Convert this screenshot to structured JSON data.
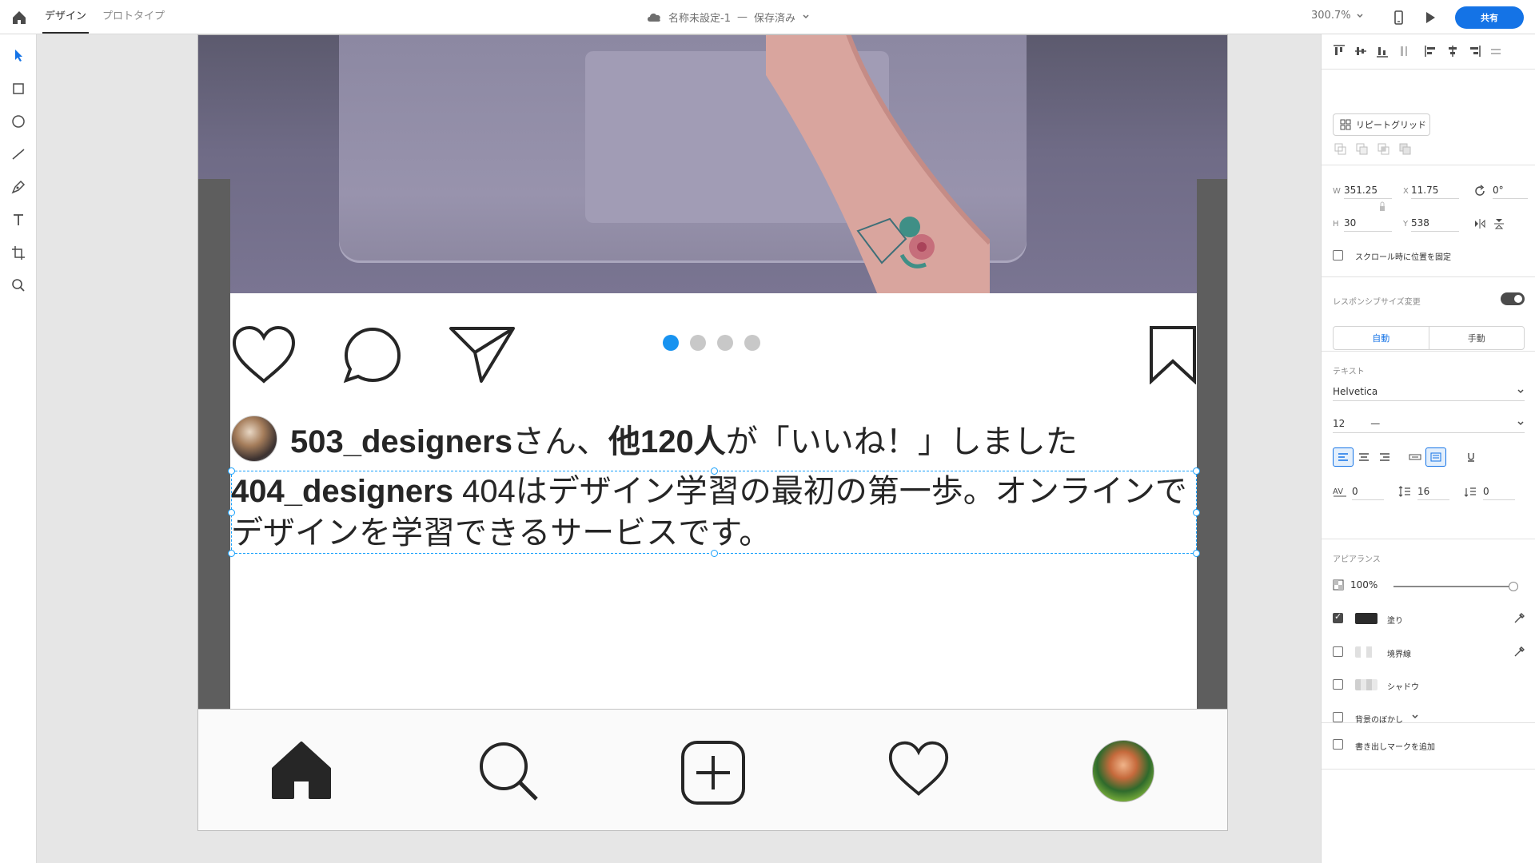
{
  "topbar": {
    "tab_design": "デザイン",
    "tab_prototype": "プロトタイプ",
    "doc_name": "名称未設定-1",
    "doc_sep": "—",
    "doc_status": "保存済み",
    "zoom": "300.7%",
    "share_label": "共有"
  },
  "post": {
    "likes_user": "503_designers",
    "likes_mid": "さん、",
    "likes_count": "他120人",
    "likes_tail": "が「いいね！」しました",
    "caption_user": "404_designers",
    "caption_text": " 404はデザイン学習の最初の第一歩。オンラインでデザインを学習できるサービスです。",
    "carousel_total": 4,
    "carousel_active": 1
  },
  "panel": {
    "repeat_grid": "リピートグリッド",
    "w_label": "W",
    "w_value": "351.25",
    "x_label": "X",
    "x_value": "11.75",
    "rotation": "0°",
    "h_label": "H",
    "h_value": "30",
    "y_label": "Y",
    "y_value": "538",
    "fix_scroll": "スクロール時に位置を固定",
    "responsive": "レスポンシブサイズ変更",
    "seg_auto": "自動",
    "seg_manual": "手動",
    "text_title": "テキスト",
    "font_family": "Helvetica",
    "font_size": "12",
    "font_weight": "—",
    "char_spacing": "0",
    "line_spacing": "16",
    "para_spacing": "0",
    "appearance_title": "アピアランス",
    "opacity": "100%",
    "fill_label": "塗り",
    "border_label": "境界線",
    "shadow_label": "シャドウ",
    "blur_label": "背景のぼかし",
    "export_mark": "書き出しマークを追加"
  },
  "colors": {
    "accent": "#1473e6",
    "selection": "#18a0fb",
    "carousel_active": "#1893f0",
    "fill_swatch": "#2b2b2b"
  }
}
